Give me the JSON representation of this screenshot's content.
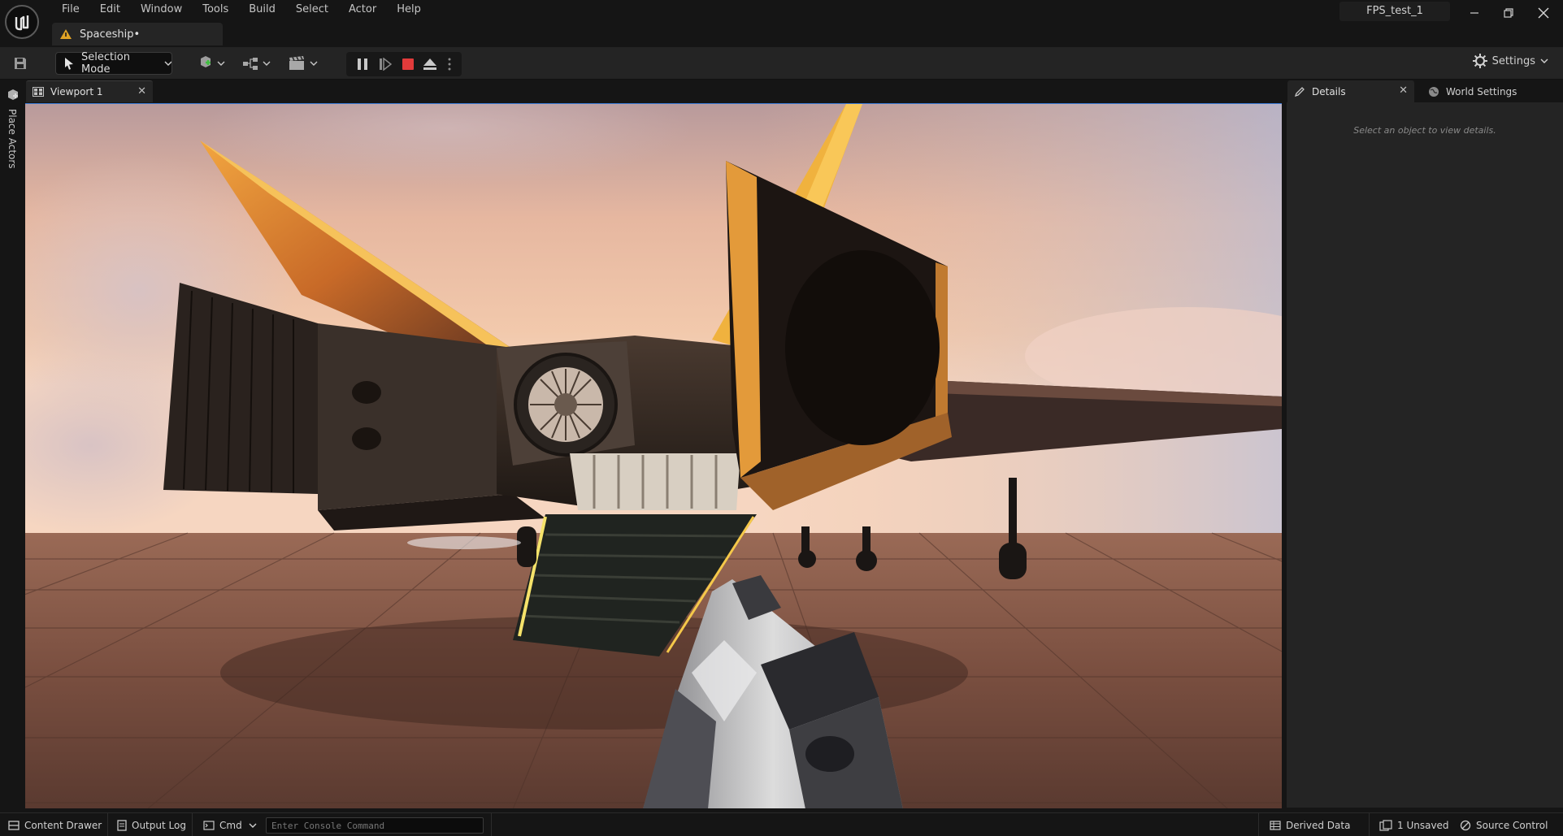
{
  "menu": [
    "File",
    "Edit",
    "Window",
    "Tools",
    "Build",
    "Select",
    "Actor",
    "Help"
  ],
  "asset_tab": {
    "label": "Spaceship•"
  },
  "project": {
    "name": "FPS_test_1"
  },
  "toolbar": {
    "mode_label": "Selection Mode",
    "settings_label": "Settings"
  },
  "left_strip": {
    "place_actors_label": "Place Actors"
  },
  "viewport": {
    "tab_label": "Viewport 1"
  },
  "details": {
    "tab_label": "Details",
    "world_tab_label": "World Settings",
    "empty_message": "Select an object to view details."
  },
  "statusbar": {
    "content_drawer": "Content Drawer",
    "output_log": "Output Log",
    "cmd": "Cmd",
    "console_placeholder": "Enter Console Command",
    "derived_data": "Derived Data",
    "unsaved": "1 Unsaved",
    "source_control": "Source Control"
  },
  "colors": {
    "accent": "#3b7bd6",
    "stop": "#e23b3b",
    "warning": "#e0a325",
    "panel": "#242424",
    "background": "#151515"
  }
}
